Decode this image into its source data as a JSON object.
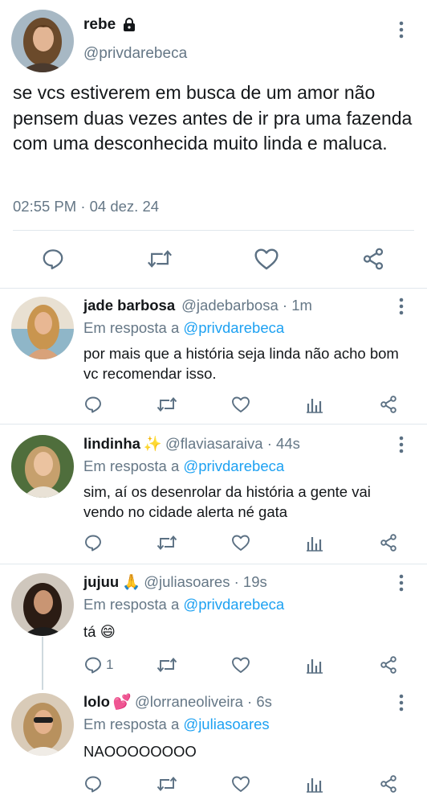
{
  "main_tweet": {
    "author_name": "rebe",
    "author_handle": "@privdarebeca",
    "text": "se vcs estiverem em busca de um amor não pensem duas vezes antes de ir pra uma fazenda com uma desconhecida muito linda e maluca.",
    "timestamp": "02:55 PM · 04 dez. 24",
    "icons": [
      "lock-icon",
      "more-icon",
      "reply-icon",
      "retweet-icon",
      "like-icon",
      "share-icon"
    ]
  },
  "replies": [
    {
      "name": "jade barbosa",
      "emoji": "",
      "handle": "@jadebarbosa",
      "dot": " · ",
      "time": "1m",
      "in_reply_prefix": "Em resposta a ",
      "in_reply_to": "@privdarebeca",
      "text": "por mais que a história seja linda não acho bom vc recomendar isso.",
      "reply_count": ""
    },
    {
      "name": "lindinha",
      "emoji": "✨",
      "handle": "@flaviasaraiva",
      "dot": " · ",
      "time": "44s",
      "in_reply_prefix": "Em resposta a ",
      "in_reply_to": "@privdarebeca",
      "text": "sim, aí os desenrolar da história a gente vai vendo no cidade alerta né gata",
      "reply_count": ""
    },
    {
      "name": "jujuu",
      "emoji": "🙏",
      "handle": "@juliasoares",
      "dot": " · ",
      "time": "19s",
      "in_reply_prefix": "Em resposta a ",
      "in_reply_to": "@privdarebeca",
      "text": "tá 😄",
      "reply_count": "1"
    },
    {
      "name": "lolo",
      "emoji": "💕",
      "handle": "@lorraneoliveira",
      "dot": " · ",
      "time": "6s",
      "in_reply_prefix": "Em resposta a ",
      "in_reply_to": "@juliasoares",
      "text": "NAOOOOOOOO",
      "reply_count": ""
    }
  ],
  "colors": {
    "text": "#14171a",
    "secondary": "#657786",
    "link": "#1da1f2",
    "divider": "#e1e8ed",
    "icon": "#5b7083"
  }
}
